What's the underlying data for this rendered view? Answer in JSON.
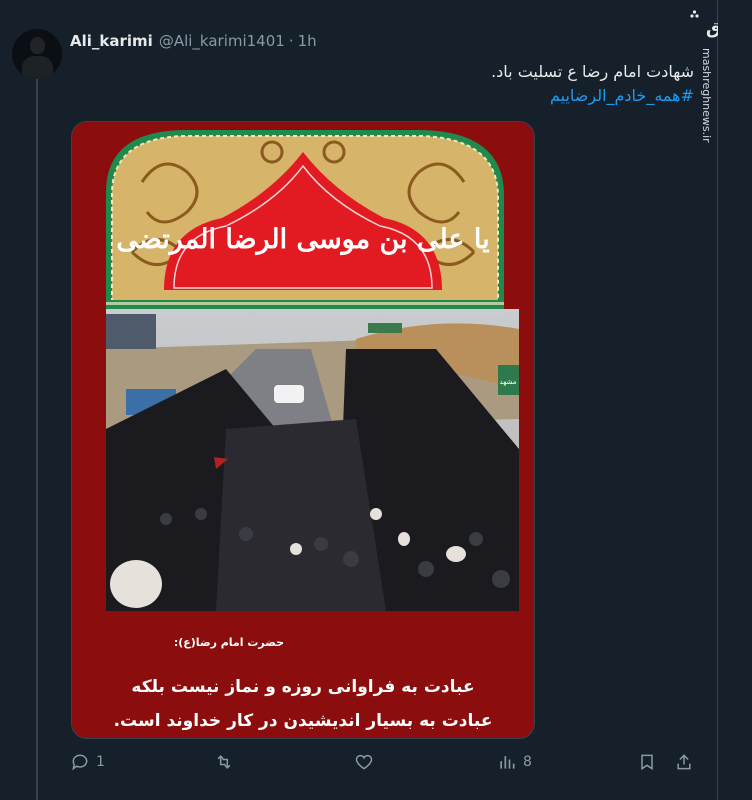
{
  "tweet": {
    "display_name": "Ali_karimi",
    "handle": "@Ali_karimi1401",
    "separator": "·",
    "time": "1h",
    "text_line1": "شهادت امام رضا ع تسلیت باد.",
    "hashtag": "#همه_خادم_الرضاییم"
  },
  "media": {
    "calligraphy_text": "یا علی بن موسی الرضا المرتضی",
    "quote_source": "حضرت امام رضا(ع):",
    "quote_line1": "عبادت به فراوانی روزه و نماز نیست بلکه",
    "quote_line2": "عبادت به بسیار اندیشیدن در کار خداوند است.",
    "road_sign_text": "مشهد"
  },
  "watermark": {
    "logo_text": "مشرق",
    "site": "mashreghnews.ir"
  },
  "actions": {
    "replies": "1",
    "views": "8"
  },
  "icons": [
    "reply-icon",
    "retweet-icon",
    "like-icon",
    "views-icon",
    "bookmark-icon",
    "share-icon"
  ],
  "colors": {
    "background": "#15202b",
    "hashtag": "#1d9bf0",
    "muted": "#8b98a5",
    "poster_red": "#8b0d0d"
  }
}
